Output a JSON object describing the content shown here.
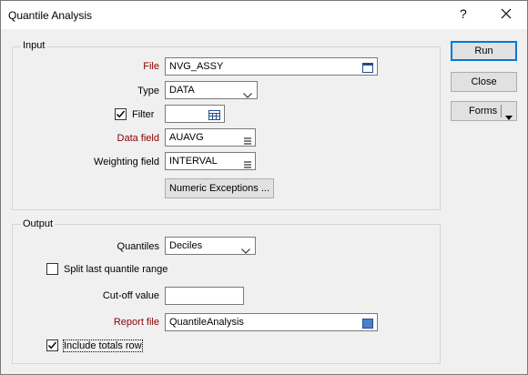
{
  "window": {
    "title": "Quantile Analysis",
    "help_label": "?"
  },
  "input": {
    "group_label": "Input",
    "file_label": "File",
    "file_value": "NVG_ASSY",
    "type_label": "Type",
    "type_value": "DATA",
    "filter_label": "Filter",
    "filter_checked": true,
    "filter_value": "",
    "data_field_label": "Data field",
    "data_field_value": "AUAVG",
    "weighting_field_label": "Weighting field",
    "weighting_field_value": "INTERVAL",
    "numeric_exceptions_label": "Numeric Exceptions ..."
  },
  "output": {
    "group_label": "Output",
    "quantiles_label": "Quantiles",
    "quantiles_value": "Deciles",
    "split_label": "Split last quantile range",
    "split_checked": false,
    "cutoff_label": "Cut-off value",
    "cutoff_value": "",
    "report_file_label": "Report file",
    "report_file_value": "QuantileAnalysis",
    "include_totals_label": "Include totals row",
    "include_totals_checked": true
  },
  "buttons": {
    "run": "Run",
    "close": "Close",
    "forms": "Forms"
  },
  "colors": {
    "accent": "#0078d7",
    "required_label": "#8b0000"
  },
  "icons": {
    "close": "close-icon",
    "file_browse": "file-browse-icon",
    "filter_browse": "filter-table-icon",
    "field_list": "list-icon",
    "dropdown": "chevron-down-icon",
    "check": "check-icon"
  }
}
